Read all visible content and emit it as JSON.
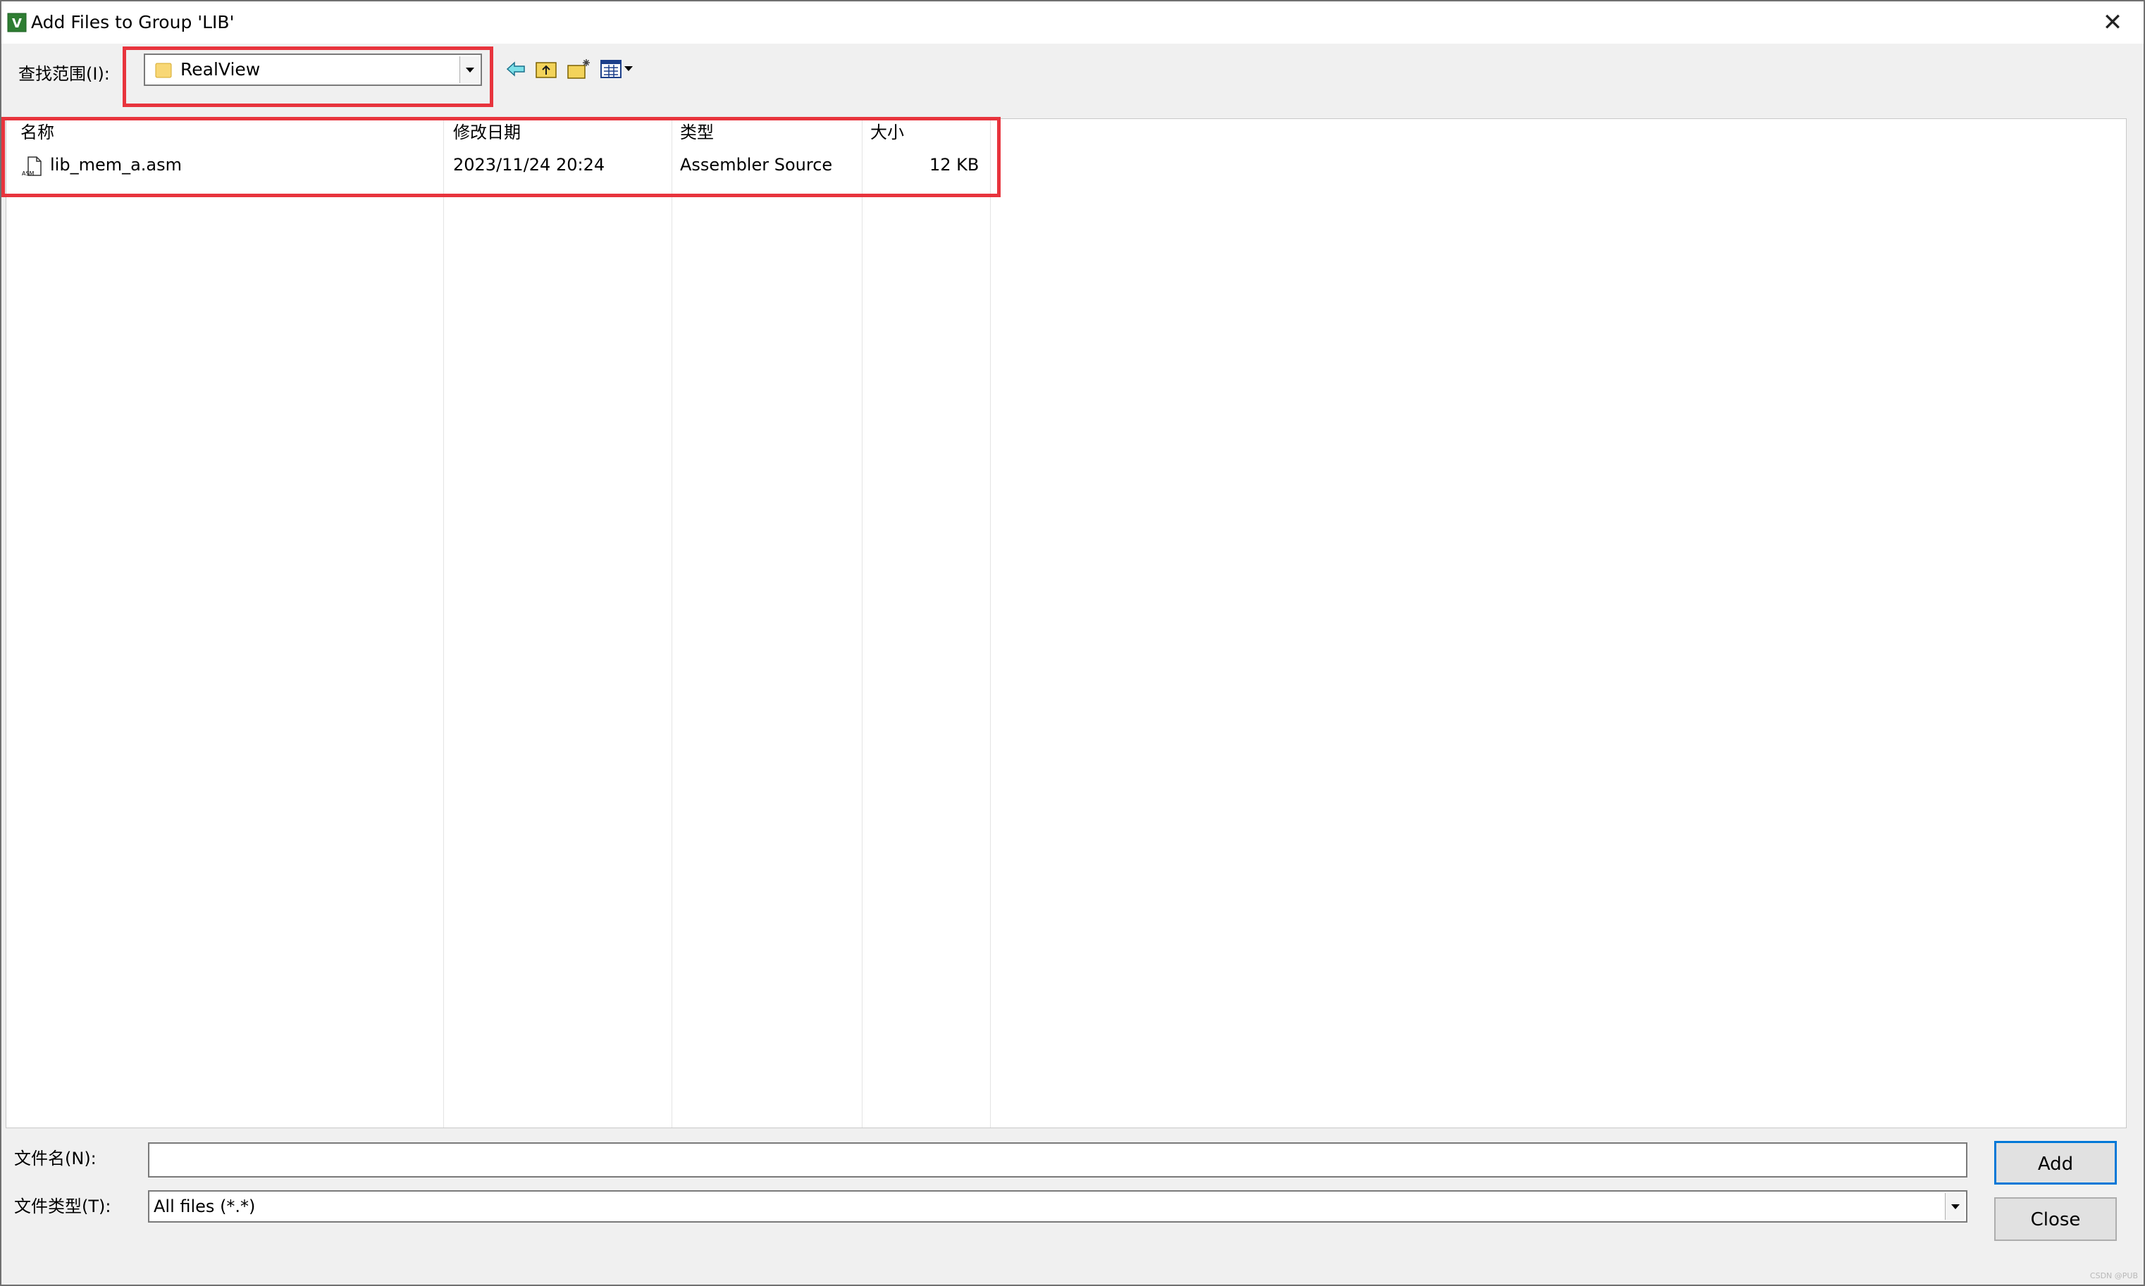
{
  "window": {
    "title": "Add Files to Group 'LIB'",
    "close_glyph": "✕"
  },
  "toolbar": {
    "lookin_label": "查找范围(I):",
    "lookin_value": "RealView",
    "icons": [
      "back-arrow-icon",
      "up-folder-icon",
      "new-folder-icon",
      "view-menu-icon"
    ]
  },
  "list": {
    "headers": [
      "名称",
      "修改日期",
      "类型",
      "大小"
    ],
    "rows": [
      {
        "name": "lib_mem_a.asm",
        "modified": "2023/11/24 20:24",
        "type": "Assembler Source",
        "size": "12 KB"
      }
    ]
  },
  "bottom": {
    "filename_label": "文件名(N):",
    "filename_value": "",
    "filetype_label": "文件类型(T):",
    "filetype_value": "All files (*.*)",
    "add_label": "Add",
    "close_label": "Close"
  },
  "watermark": "CSDN @PUB",
  "colors": {
    "highlight": "#e8343d",
    "default_button_border": "#0078d7",
    "folder_yellow": "#f8d775"
  }
}
